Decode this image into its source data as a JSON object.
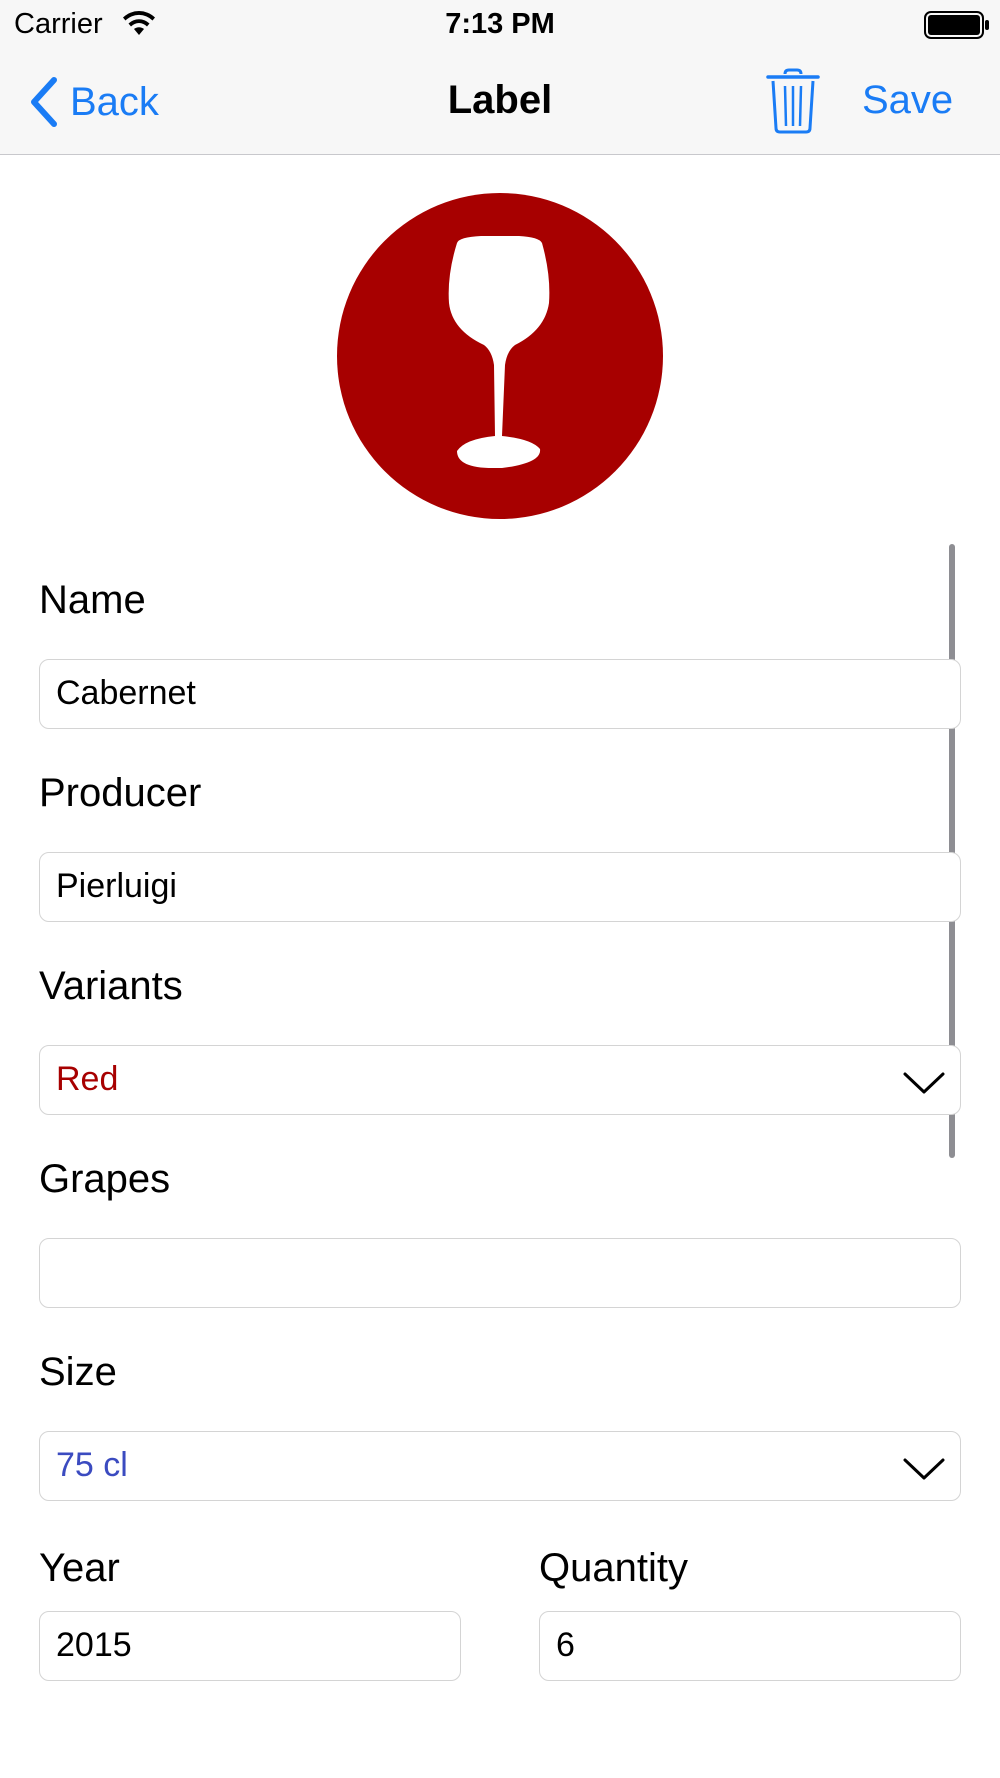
{
  "status_bar": {
    "carrier": "Carrier",
    "time": "7:13 PM",
    "icons": [
      "wifi-icon",
      "battery-icon"
    ]
  },
  "nav": {
    "back_label": "Back",
    "title": "Label",
    "save_label": "Save",
    "icons": [
      "chevron-left-icon",
      "trash-icon"
    ],
    "accent_color": "#1a7cf5"
  },
  "wine_icon": {
    "icon": "wine-glass-icon",
    "color": "#a70000"
  },
  "form": {
    "name": {
      "label": "Name",
      "value": "Cabernet"
    },
    "producer": {
      "label": "Producer",
      "value": "Pierluigi"
    },
    "variants": {
      "label": "Variants",
      "value": "Red",
      "value_color": "#a70000"
    },
    "grapes": {
      "label": "Grapes",
      "value": ""
    },
    "size": {
      "label": "Size",
      "value": "75 cl",
      "value_color": "#3b4bc0"
    },
    "year": {
      "label": "Year",
      "value": "2015"
    },
    "quantity": {
      "label": "Quantity",
      "value": "6"
    }
  }
}
